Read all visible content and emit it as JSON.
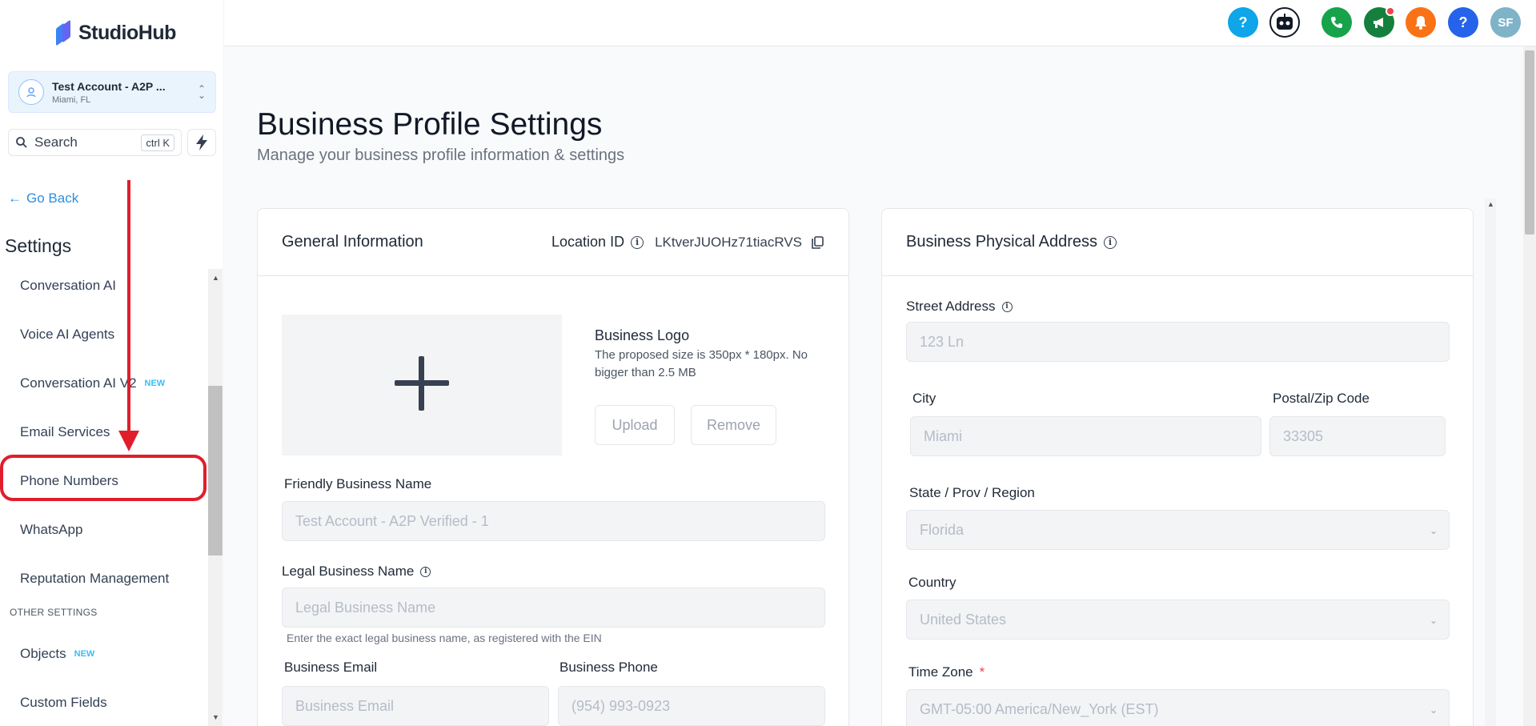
{
  "brand": {
    "name": "StudioHub"
  },
  "account": {
    "name": "Test Account - A2P ...",
    "location": "Miami, FL"
  },
  "search": {
    "label": "Search",
    "shortcut": "ctrl K"
  },
  "sidebar": {
    "go_back": "Go Back",
    "section_title": "Settings",
    "items": [
      {
        "label": "Conversation AI",
        "badge": ""
      },
      {
        "label": "Voice AI Agents",
        "badge": ""
      },
      {
        "label": "Conversation AI V2",
        "badge": "NEW"
      },
      {
        "label": "Email Services",
        "badge": ""
      },
      {
        "label": "Phone Numbers",
        "badge": ""
      },
      {
        "label": "WhatsApp",
        "badge": ""
      },
      {
        "label": "Reputation Management",
        "badge": ""
      }
    ],
    "other_settings_label": "OTHER SETTINGS",
    "other_items": [
      {
        "label": "Objects",
        "badge": "NEW"
      },
      {
        "label": "Custom Fields",
        "badge": ""
      }
    ]
  },
  "topbar": {
    "icons": [
      {
        "name": "help",
        "glyph": "?",
        "color": "#0ea5e9"
      },
      {
        "name": "ai-bot",
        "glyph": "",
        "color": "#111827"
      },
      {
        "name": "phone",
        "glyph": "✆",
        "color": "#16a34a"
      },
      {
        "name": "announcements",
        "glyph": "📢",
        "color": "#15803d"
      },
      {
        "name": "notifications",
        "glyph": "🔔",
        "color": "#f97316"
      },
      {
        "name": "support",
        "glyph": "?",
        "color": "#2563eb"
      }
    ],
    "user_initials": "SF"
  },
  "page": {
    "title": "Business Profile Settings",
    "subtitle": "Manage your business profile information & settings"
  },
  "general": {
    "heading": "General Information",
    "location_id_label": "Location ID",
    "location_id": "LKtverJUOHz71tiacRVS",
    "logo_title": "Business Logo",
    "logo_desc": "The proposed size is 350px * 180px. No bigger than 2.5 MB",
    "upload_label": "Upload",
    "remove_label": "Remove",
    "friendly_name_label": "Friendly Business Name",
    "friendly_name_value": "Test Account - A2P Verified - 1",
    "legal_name_label": "Legal Business Name",
    "legal_name_placeholder": "Legal Business Name",
    "legal_name_hint": "Enter the exact legal business name, as registered with the EIN",
    "email_label": "Business Email",
    "email_placeholder": "Business Email",
    "phone_label": "Business Phone",
    "phone_placeholder": "(954) 993-0923"
  },
  "address": {
    "heading": "Business Physical Address",
    "street_label": "Street Address",
    "street_placeholder": "123 Ln",
    "city_label": "City",
    "city_value": "Miami",
    "zip_label": "Postal/Zip Code",
    "zip_value": "33305",
    "state_label": "State / Prov / Region",
    "state_value": "Florida",
    "country_label": "Country",
    "country_value": "United States",
    "timezone_label": "Time Zone",
    "timezone_required": "*",
    "timezone_value": "GMT-05:00 America/New_York (EST)"
  }
}
